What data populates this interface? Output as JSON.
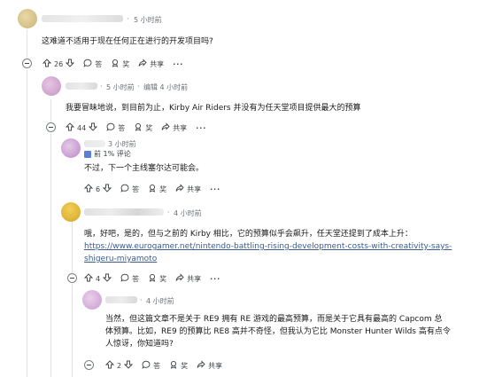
{
  "comments": [
    {
      "time": "5 小时前",
      "edited": "",
      "body": "这难道不适用于现在任何正在进行的开发项目吗?",
      "votes": "26",
      "reply_label": "答",
      "award_label": "奖",
      "share_label": "共享",
      "more_label": "···"
    },
    {
      "time": "5 小时前",
      "edited": "编辑 4 小时前",
      "body": "我要冒昧地说，到目前为止，Kirby Air Riders 并没有为任天堂项目提供最大的预算",
      "votes": "44",
      "reply_label": "答",
      "award_label": "奖",
      "share_label": "共享",
      "more_label": "···"
    },
    {
      "time": "3 小时前",
      "badge": "前 1% 评论",
      "body": "不过，下一个主线塞尔达可能会。",
      "votes": "6",
      "reply_label": "答",
      "award_label": "奖",
      "share_label": "共享",
      "more_label": "···"
    },
    {
      "time": "4 小时前",
      "body_line1": "哦，好吧，是的，但与之前的 Kirby 相比，它的预算似乎会飙升，任天堂还提到了成本上升：",
      "link_line1": "https://www.eurogamer.net/nintendo-battling-rising-development-costs-with-creativity-says-",
      "link_line2": "shigeru-miyamoto",
      "votes": "4",
      "reply_label": "答",
      "award_label": "奖",
      "share_label": "共享",
      "more_label": "···"
    },
    {
      "time": "4 小时前",
      "body_line1": "当然，但这篇文章不是关于 RE9 拥有 RE 游戏的最高预算，而是关于它具有最高的 Capcom 总",
      "body_line2": "体预算。比如，RE9 的预算比 RE8 高并不奇怪，但我认为它比 Monster Hunter Wilds 高有点令",
      "body_line3": "人惊讶，你知道吗?",
      "votes": "2",
      "reply_label": "答",
      "award_label": "奖",
      "share_label": "共享"
    }
  ],
  "separator": "·"
}
